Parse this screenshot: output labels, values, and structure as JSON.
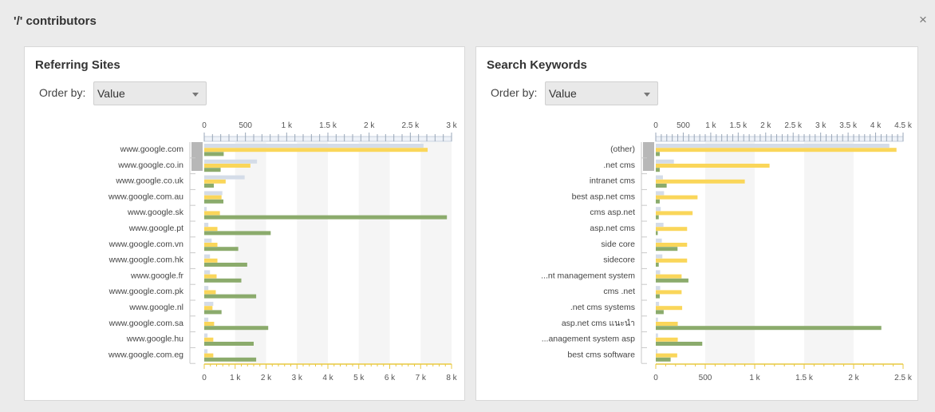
{
  "dialog": {
    "title": "'/' contributors",
    "close_label": "×"
  },
  "panels": [
    {
      "title": "Referring Sites",
      "order_label": "Order by:",
      "order_value": "Value"
    },
    {
      "title": "Search Keywords",
      "order_label": "Order by:",
      "order_value": "Value"
    }
  ],
  "colors": {
    "grey": "#d4dce8",
    "yellow": "#fad65a",
    "green": "#8bab6c",
    "axis": "#e8c840"
  },
  "chart_data": [
    {
      "type": "bar",
      "orientation": "horizontal",
      "categories": [
        "www.google.com",
        "www.google.co.in",
        "www.google.co.uk",
        "www.google.com.au",
        "www.google.sk",
        "www.google.pt",
        "www.google.com.vn",
        "www.google.com.hk",
        "www.google.fr",
        "www.google.com.pk",
        "www.google.nl",
        "www.google.com.sa",
        "www.google.hu",
        "www.google.com.eg"
      ],
      "top_axis": {
        "min": 0,
        "max": 3000,
        "ticks": [
          0,
          500,
          1000,
          1500,
          2000,
          2500,
          3000
        ],
        "tick_labels": [
          "0",
          "500",
          "1 k",
          "1.5 k",
          "2 k",
          "2.5 k",
          "3 k"
        ]
      },
      "bottom_axis": {
        "min": 0,
        "max": 8000,
        "ticks": [
          0,
          1000,
          2000,
          3000,
          4000,
          5000,
          6000,
          7000,
          8000
        ],
        "tick_labels": [
          "0",
          "1 k",
          "2 k",
          "3 k",
          "4 k",
          "5 k",
          "6 k",
          "7 k",
          "8 k"
        ]
      },
      "series": [
        {
          "axis": "top",
          "color_key": "grey",
          "values": [
            2660,
            640,
            490,
            220,
            30,
            50,
            90,
            70,
            70,
            50,
            110,
            50,
            40,
            40
          ]
        },
        {
          "axis": "top",
          "color_key": "yellow",
          "values": [
            2710,
            560,
            260,
            210,
            190,
            160,
            160,
            160,
            150,
            140,
            100,
            120,
            110,
            110
          ]
        },
        {
          "axis": "bottom",
          "color_key": "green",
          "values": [
            630,
            530,
            310,
            620,
            7850,
            2150,
            1100,
            1390,
            1200,
            1680,
            560,
            2070,
            1600,
            1680
          ]
        }
      ]
    },
    {
      "type": "bar",
      "orientation": "horizontal",
      "categories": [
        "(other)",
        ".net cms",
        "intranet cms",
        "best asp.net cms",
        "cms asp.net",
        "asp.net cms",
        "side core",
        "sidecore",
        "...nt management system",
        "cms .net",
        ".net cms systems",
        "asp.net cms แนะนำ",
        "...anagement system asp",
        "best cms software"
      ],
      "top_axis": {
        "min": 0,
        "max": 4500,
        "ticks": [
          0,
          500,
          1000,
          1500,
          2000,
          2500,
          3000,
          3500,
          4000,
          4500
        ],
        "tick_labels": [
          "0",
          "500",
          "1 k",
          "1.5 k",
          "2 k",
          "2.5 k",
          "3 k",
          "3.5 k",
          "4 k",
          "4.5 k"
        ]
      },
      "bottom_axis": {
        "min": 0,
        "max": 2500,
        "ticks": [
          0,
          500,
          1000,
          1500,
          2000,
          2500
        ],
        "tick_labels": [
          "0",
          "500",
          "1 k",
          "1.5 k",
          "2 k",
          "2.5 k"
        ]
      },
      "series": [
        {
          "axis": "top",
          "color_key": "grey",
          "values": [
            4250,
            330,
            130,
            150,
            90,
            140,
            110,
            120,
            80,
            80,
            60,
            40,
            40,
            30
          ]
        },
        {
          "axis": "top",
          "color_key": "yellow",
          "values": [
            4380,
            2070,
            1620,
            760,
            670,
            570,
            570,
            570,
            470,
            470,
            480,
            400,
            400,
            390
          ]
        },
        {
          "axis": "bottom",
          "color_key": "green",
          "values": [
            40,
            40,
            110,
            40,
            30,
            20,
            220,
            30,
            330,
            40,
            80,
            2280,
            470,
            150
          ]
        }
      ]
    }
  ]
}
